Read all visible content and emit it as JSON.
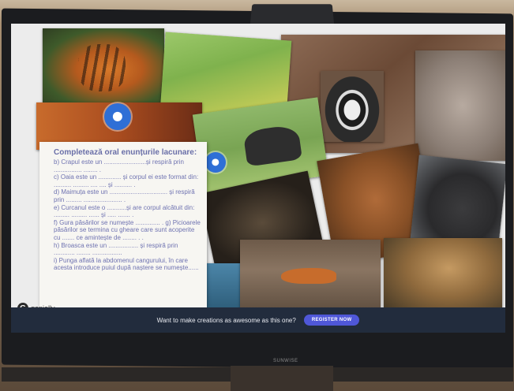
{
  "quiz": {
    "title": "Completează oral enunțurile lacunare:",
    "items": [
      "b) Crapul este un ........................și respiră prin ................ ........ .",
      "c) Oaia este un ............. și corpul ei este format din: .......... ......... .... .... și .......... .",
      "d) Maimuța este un ................................. și respiră prin ......... ...................... .",
      "e) Curcanul este o ...........și are corpul alcătuit din: ......... ......... ...... și ..... ....... .",
      "f) Gura păsărilor se numește .............. . g) Picioarele păsărilor se termina cu gheare care sunt acoperite cu ....... ce amintește de ........ . .",
      "h) Broasca este un ................. și respiră prin ............ ........ .................",
      "i) Punga aflată la abdomenul cangurului, în care acesta introduce puiul după naștere se numește......"
    ]
  },
  "logo": {
    "icon": "G",
    "text": "genially"
  },
  "banner": {
    "message": "Want to make creations as awesome as this one?",
    "button": "REGISTER NOW"
  },
  "tv": {
    "brand": "SUNWISE"
  },
  "colors": {
    "question_text": "#6f73b1",
    "hotspot": "#2f6fd6",
    "banner_bg": "#222c3d",
    "button_bg": "#4f57d8"
  },
  "images": [
    "tiger-photo",
    "grass-hare-photo",
    "rocks-badger-photo",
    "rhino-goat-photo",
    "autumn-leaves-photo",
    "elephants-photo",
    "brown-bear-photo",
    "wild-boar-photo",
    "bat-photo",
    "fox-photo",
    "lynx-photo",
    "water-photo"
  ]
}
